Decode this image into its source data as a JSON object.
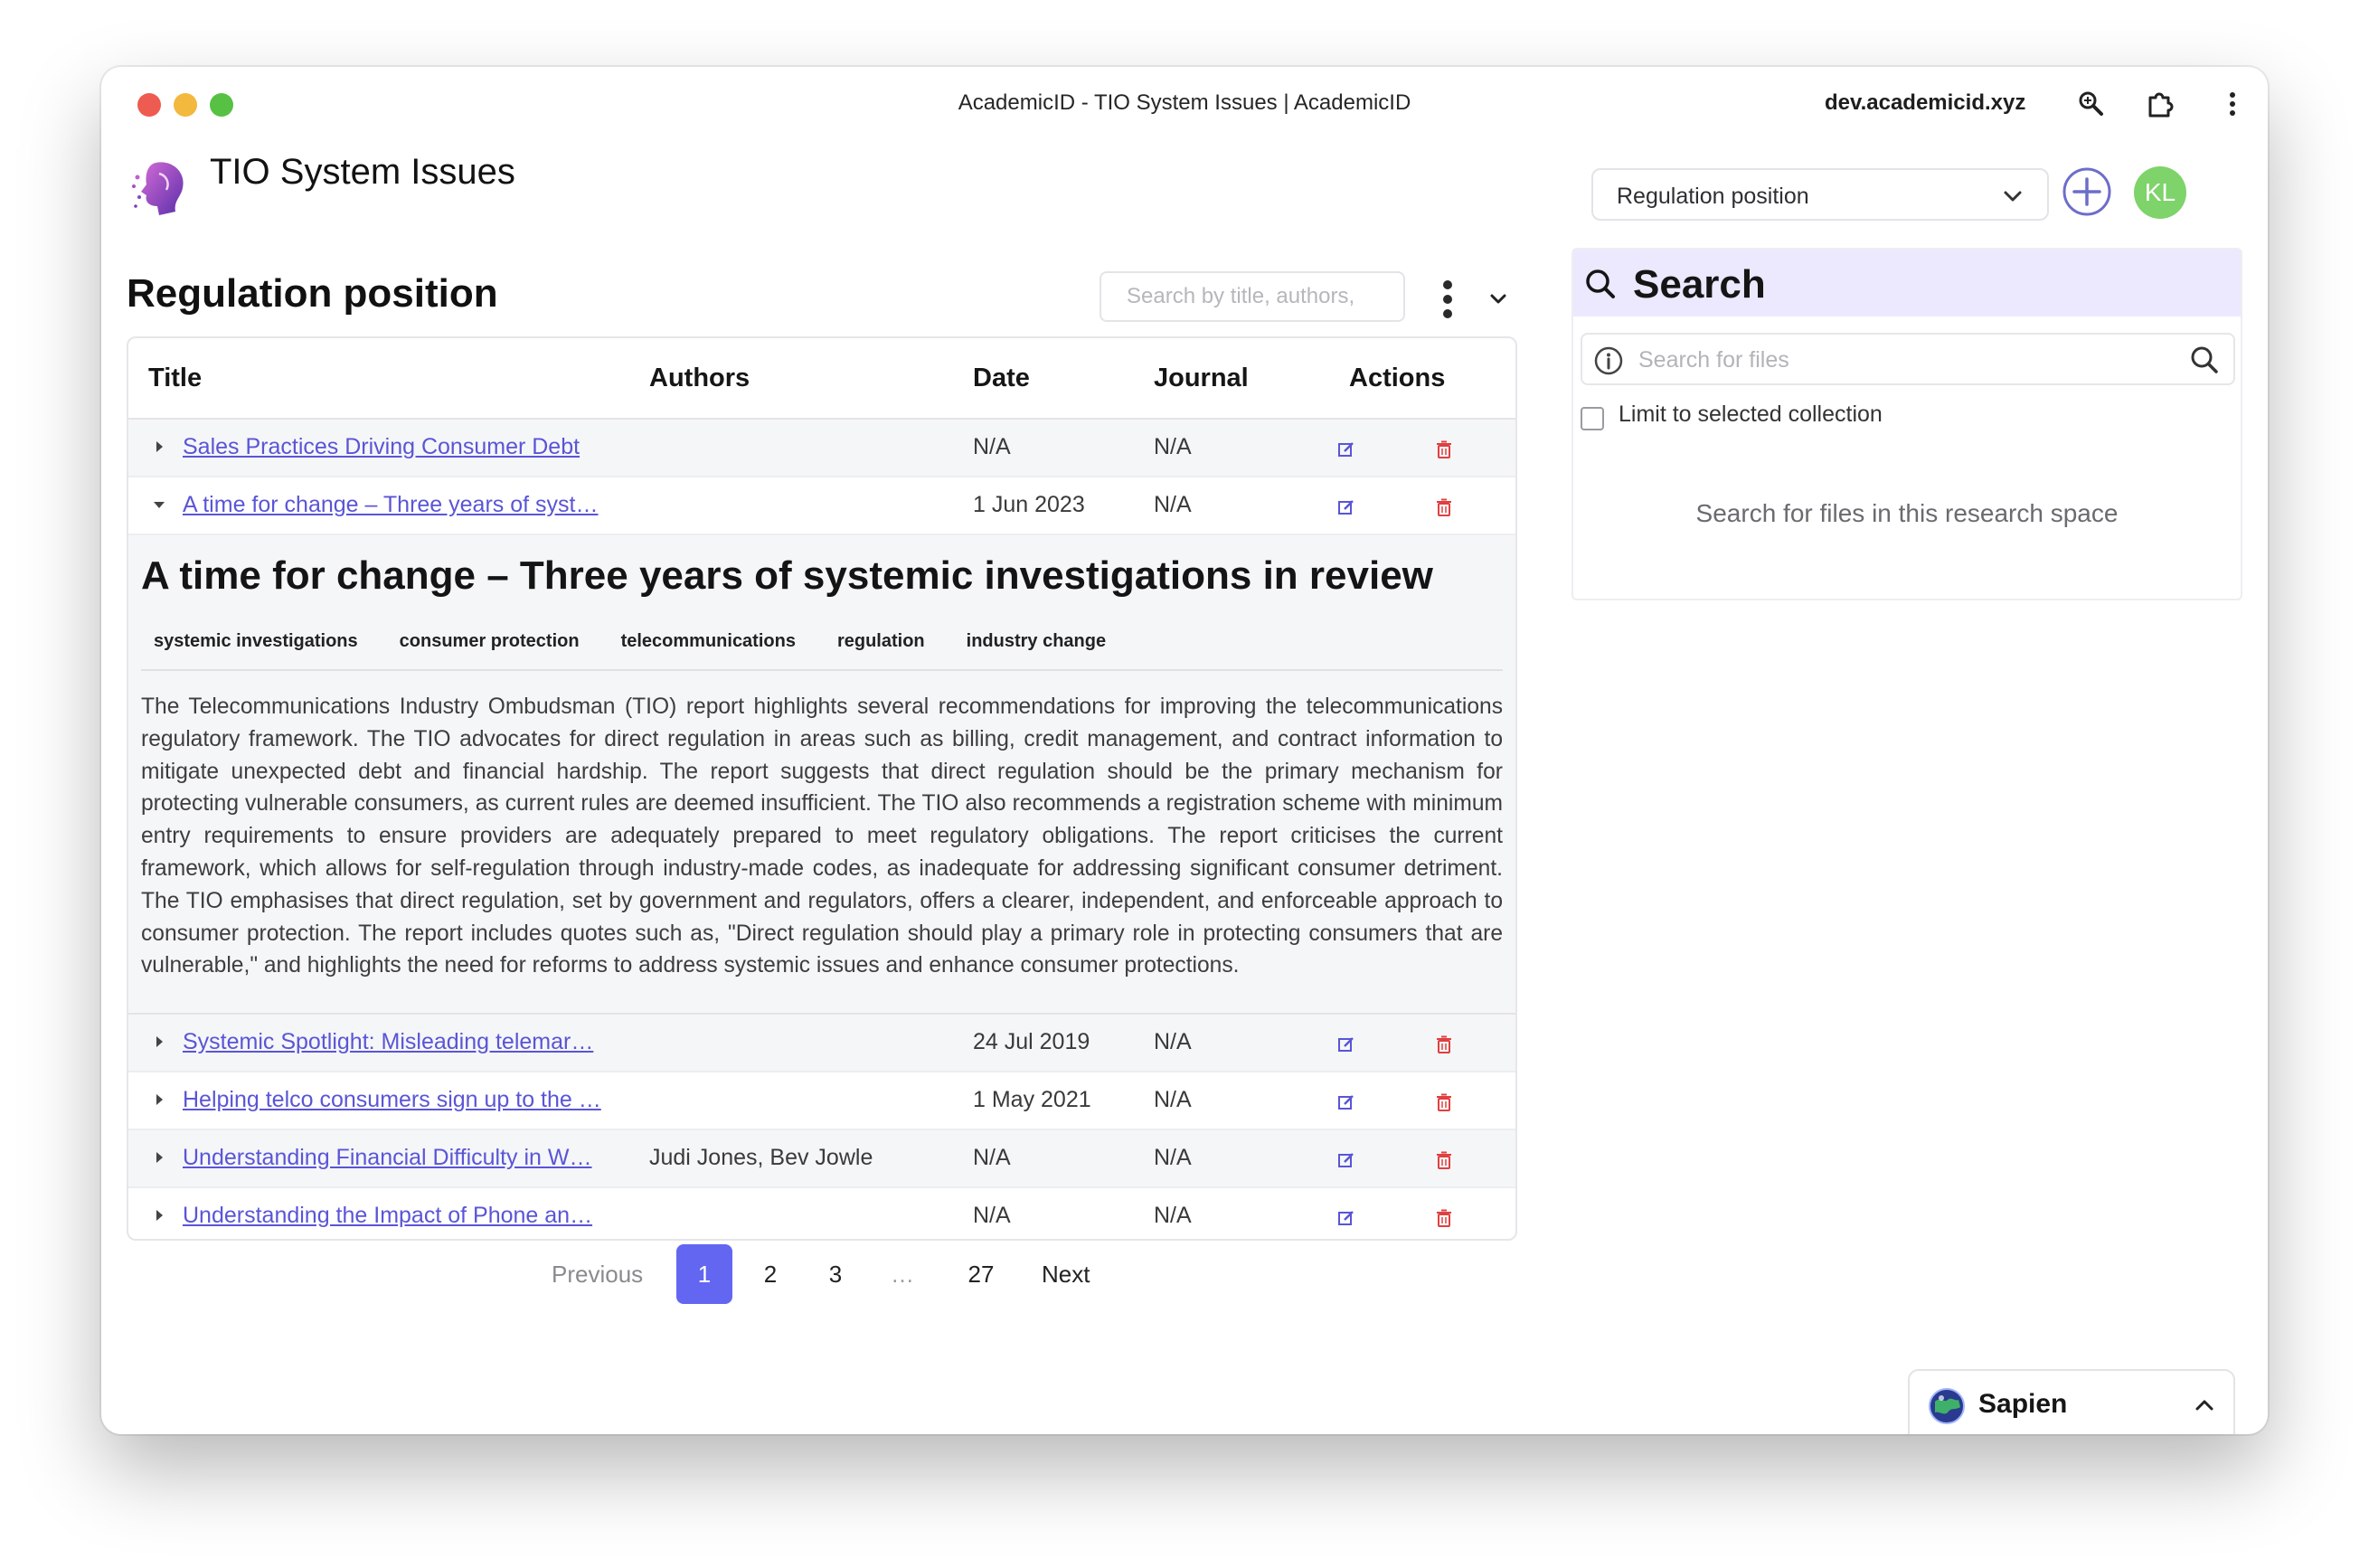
{
  "window": {
    "title": "AcademicID - TIO System Issues | AcademicID",
    "domain": "dev.academicid.xyz"
  },
  "header": {
    "app_title": "TIO System Issues",
    "collection_select": "Regulation position",
    "avatar_initials": "KL",
    "avatar_color": "#7ed36b"
  },
  "section": {
    "title": "Regulation position",
    "search_placeholder": "Search by title, authors,"
  },
  "table": {
    "columns": [
      "Title",
      "Authors",
      "Date",
      "Journal",
      "Actions"
    ],
    "rows": [
      {
        "title": "Sales Practices Driving Consumer Debt",
        "authors": "",
        "date": "N/A",
        "journal": "N/A",
        "expanded": false
      },
      {
        "title": "A time for change – Three years of syst…",
        "authors": "",
        "date": "1 Jun 2023",
        "journal": "N/A",
        "expanded": true
      },
      {
        "title": "Systemic Spotlight: Misleading telemar…",
        "authors": "",
        "date": "24 Jul 2019",
        "journal": "N/A",
        "expanded": false
      },
      {
        "title": "Helping telco consumers sign up to the …",
        "authors": "",
        "date": "1 May 2021",
        "journal": "N/A",
        "expanded": false
      },
      {
        "title": "Understanding Financial Difficulty in W…",
        "authors": "Judi Jones, Bev Jowle",
        "date": "N/A",
        "journal": "N/A",
        "expanded": false
      },
      {
        "title": "Understanding the Impact of Phone an…",
        "authors": "",
        "date": "N/A",
        "journal": "N/A",
        "expanded": false
      }
    ],
    "detail": {
      "title": "A time for change – Three years of systemic investigations in review",
      "tags": [
        "systemic investigations",
        "consumer protection",
        "telecommunications",
        "regulation",
        "industry change"
      ],
      "summary": "The Telecommunications Industry Ombudsman (TIO) report highlights several recommendations for improving the telecommunications regulatory framework. The TIO advocates for direct regulation in areas such as billing, credit management, and contract information to mitigate unexpected debt and financial hardship. The report suggests that direct regulation should be the primary mechanism for protecting vulnerable consumers, as current rules are deemed insufficient. The TIO also recommends a registration scheme with minimum entry requirements to ensure providers are adequately prepared to meet regulatory obligations. The report criticises the current framework, which allows for self-regulation through industry-made codes, as inadequate for addressing significant consumer detriment. The TIO emphasises that direct regulation, set by government and regulators, offers a clearer, independent, and enforceable approach to consumer protection. The report includes quotes such as, \"Direct regulation should play a primary role in protecting consumers that are vulnerable,\" and highlights the need for reforms to address systemic issues and enhance consumer protections."
    }
  },
  "pagination": {
    "previous": "Previous",
    "pages": [
      "1",
      "2",
      "3",
      "…",
      "27"
    ],
    "current": "1",
    "next": "Next"
  },
  "search_panel": {
    "title": "Search",
    "placeholder": "Search for files",
    "limit_label": "Limit to selected collection",
    "empty_message": "Search for files in this research space"
  },
  "sapien": {
    "name": "Sapien"
  },
  "colors": {
    "accent": "#6366f1",
    "link": "#5a55d6",
    "delete": "#e04040",
    "search_header_bg": "#ece8fd"
  },
  "icons": [
    "zoom-icon",
    "extension-icon",
    "kebab-icon",
    "logo-icon",
    "chevron-down-icon",
    "add-icon",
    "more-vertical-icon",
    "caret-right-icon",
    "caret-down-icon",
    "edit-icon",
    "trash-icon",
    "search-icon",
    "info-icon",
    "globe-icon",
    "chevron-up-icon"
  ]
}
